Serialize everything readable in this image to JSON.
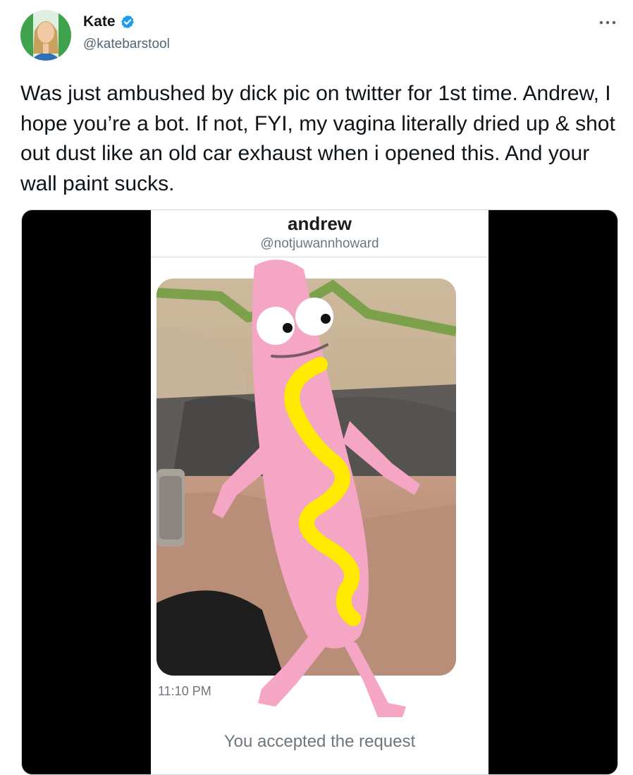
{
  "tweet": {
    "author_name": "Kate",
    "author_handle": "@katebarstool",
    "text": "Was just ambushed by dick pic on twitter for 1st time. Andrew, I hope you’re a bot. If not, FYI, my vagina literally dried up & shot out dust like an old car exhaust when i opened this. And your wall paint sucks.",
    "verified": true,
    "more_icon": "more-horizontal-icon"
  },
  "media": {
    "dm_header": {
      "name": "andrew",
      "handle": "@notjuwannhoward"
    },
    "message_time": "11:10 PM",
    "status_text": "You accepted the request",
    "sticker": "hotdog-character-sticker"
  },
  "colors": {
    "verified_blue": "#1d9bf0",
    "text_primary": "#0f1419",
    "text_secondary": "#536471",
    "sticker_pink": "#f4a6c4",
    "mustard": "#ffea00"
  }
}
